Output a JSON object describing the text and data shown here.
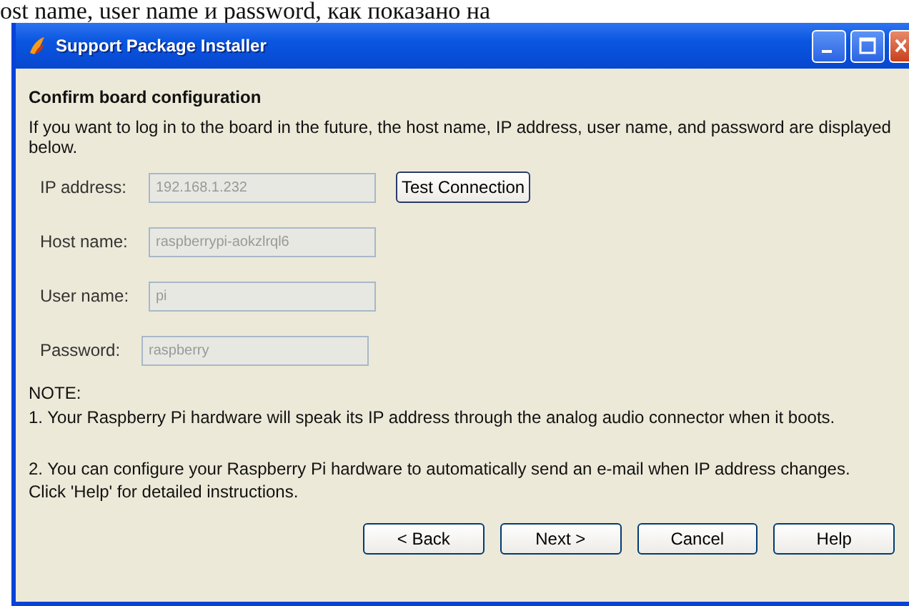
{
  "page_caption": "ost name, user name и password, как показано на",
  "window": {
    "title": "Support Package Installer"
  },
  "heading": "Confirm board configuration",
  "intro": "If you want to log in to the board in the future, the host name, IP address, user name, and password are displayed below.",
  "fields": [
    {
      "label": "IP address:",
      "value": "192.168.1.232",
      "disabled": true
    },
    {
      "label": "Host name:",
      "value": "raspberrypi-aokzlrql6",
      "disabled": true
    },
    {
      "label": "User name:",
      "value": "pi",
      "disabled": true
    },
    {
      "label": "Password:",
      "value": "raspberry",
      "disabled": true
    }
  ],
  "test_button": "Test Connection",
  "note_title": "NOTE:",
  "notes": [
    " 1. Your Raspberry Pi hardware will speak its IP address through the analog audio connector when it boots.",
    " 2. You can configure your Raspberry Pi hardware to automatically send an e-mail when IP address changes. Click 'Help' for detailed instructions."
  ],
  "buttons": [
    "< Back",
    "Next >",
    "Cancel",
    "Help"
  ]
}
